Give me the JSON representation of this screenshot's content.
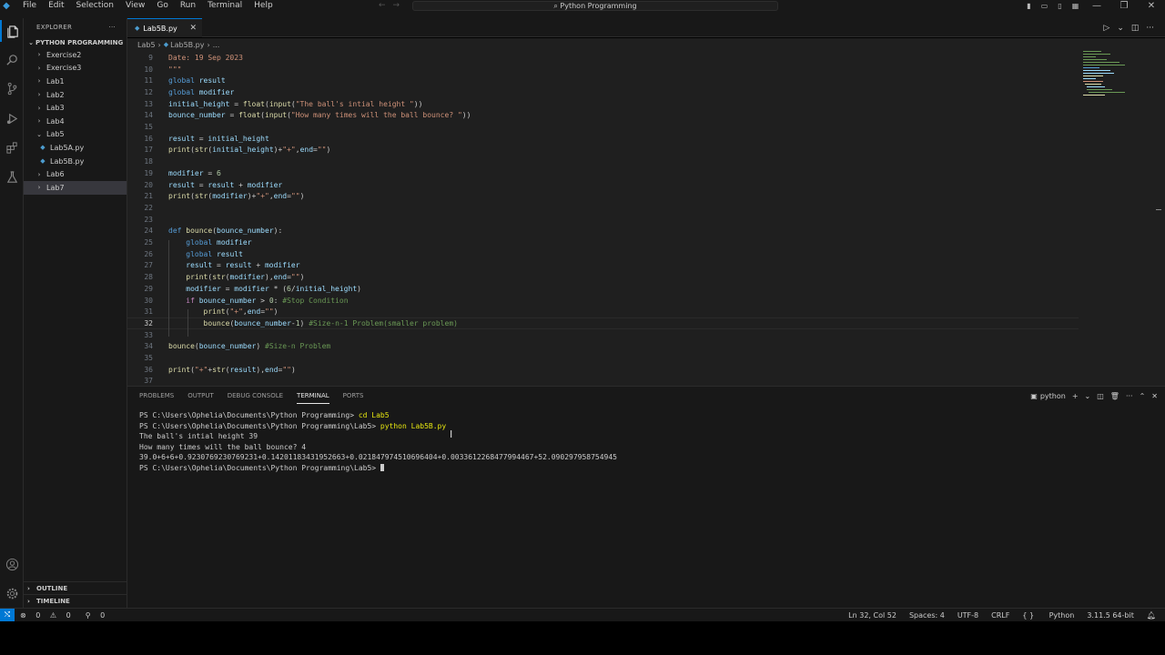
{
  "menu": [
    "File",
    "Edit",
    "Selection",
    "View",
    "Go",
    "Run",
    "Terminal",
    "Help"
  ],
  "command_center": "Python Programming",
  "sidebar": {
    "header": "EXPLORER",
    "project": "PYTHON PROGRAMMING",
    "items": [
      {
        "label": "Exercise2",
        "type": "folder",
        "expanded": false,
        "depth": 1
      },
      {
        "label": "Exercise3",
        "type": "folder",
        "expanded": false,
        "depth": 1
      },
      {
        "label": "Lab1",
        "type": "folder",
        "expanded": false,
        "depth": 1
      },
      {
        "label": "Lab2",
        "type": "folder",
        "expanded": false,
        "depth": 1
      },
      {
        "label": "Lab3",
        "type": "folder",
        "expanded": false,
        "depth": 1
      },
      {
        "label": "Lab4",
        "type": "folder",
        "expanded": false,
        "depth": 1
      },
      {
        "label": "Lab5",
        "type": "folder",
        "expanded": true,
        "depth": 1
      },
      {
        "label": "Lab5A.py",
        "type": "file",
        "depth": 2
      },
      {
        "label": "Lab5B.py",
        "type": "file",
        "depth": 2
      },
      {
        "label": "Lab6",
        "type": "folder",
        "expanded": false,
        "depth": 1
      },
      {
        "label": "Lab7",
        "type": "folder",
        "expanded": false,
        "depth": 1,
        "selected": true
      }
    ],
    "outline": "OUTLINE",
    "timeline": "TIMELINE"
  },
  "tab": {
    "label": "Lab5B.py"
  },
  "breadcrumb": [
    "Lab5",
    "Lab5B.py",
    "..."
  ],
  "editor": {
    "current_line": 32,
    "lines": [
      {
        "n": 9,
        "html": "<span class='str'>Date: 19 Sep 2023</span>"
      },
      {
        "n": 10,
        "html": "<span class='str'>\"\"\"</span>"
      },
      {
        "n": 11,
        "html": "<span class='kw'>global</span> <span class='var'>result</span>"
      },
      {
        "n": 12,
        "html": "<span class='kw'>global</span> <span class='var'>modifier</span>"
      },
      {
        "n": 13,
        "html": "<span class='var'>initial_height</span> = <span class='fn'>float</span>(<span class='fn'>input</span>(<span class='str'>\"The ball's intial height \"</span>))"
      },
      {
        "n": 14,
        "html": "<span class='var'>bounce_number</span> = <span class='fn'>float</span>(<span class='fn'>input</span>(<span class='str'>\"How many times will the ball bounce? \"</span>))"
      },
      {
        "n": 15,
        "html": ""
      },
      {
        "n": 16,
        "html": "<span class='var'>result</span> = <span class='var'>initial_height</span>"
      },
      {
        "n": 17,
        "html": "<span class='fn'>print</span>(<span class='fn'>str</span>(<span class='var'>initial_height</span>)+<span class='str'>\"+\"</span>,<span class='var'>end</span>=<span class='str'>\"\"</span>)"
      },
      {
        "n": 18,
        "html": ""
      },
      {
        "n": 19,
        "html": "<span class='var'>modifier</span> = <span class='num'>6</span>"
      },
      {
        "n": 20,
        "html": "<span class='var'>result</span> = <span class='var'>result</span> + <span class='var'>modifier</span>"
      },
      {
        "n": 21,
        "html": "<span class='fn'>print</span>(<span class='fn'>str</span>(<span class='var'>modifier</span>)+<span class='str'>\"+\"</span>,<span class='var'>end</span>=<span class='str'>\"\"</span>)"
      },
      {
        "n": 22,
        "html": ""
      },
      {
        "n": 23,
        "html": ""
      },
      {
        "n": 24,
        "html": "<span class='kw'>def</span> <span class='fn'>bounce</span>(<span class='var'>bounce_number</span>):"
      },
      {
        "n": 25,
        "html": "    <span class='kw'>global</span> <span class='var'>modifier</span>"
      },
      {
        "n": 26,
        "html": "    <span class='kw'>global</span> <span class='var'>result</span>"
      },
      {
        "n": 27,
        "html": "    <span class='var'>result</span> = <span class='var'>result</span> + <span class='var'>modifier</span>"
      },
      {
        "n": 28,
        "html": "    <span class='fn'>print</span>(<span class='fn'>str</span>(<span class='var'>modifier</span>),<span class='var'>end</span>=<span class='str'>\"\"</span>)"
      },
      {
        "n": 29,
        "html": "    <span class='var'>modifier</span> = <span class='var'>modifier</span> * (<span class='num'>6</span>/<span class='var'>initial_height</span>)"
      },
      {
        "n": 30,
        "html": "    <span class='kw2'>if</span> <span class='var'>bounce_number</span> &gt; <span class='num'>0</span>: <span class='com'>#Stop Condition</span>"
      },
      {
        "n": 31,
        "html": "        <span class='fn'>print</span>(<span class='str'>\"+\"</span>,<span class='var'>end</span>=<span class='str'>\"\"</span>)"
      },
      {
        "n": 32,
        "html": "        <span class='fn'>bounce</span>(<span class='var'>bounce_number</span>-<span class='num'>1</span>) <span class='com'>#Size-n-1 Problem(smaller problem)</span>"
      },
      {
        "n": 33,
        "html": ""
      },
      {
        "n": 34,
        "html": "<span class='fn'>bounce</span>(<span class='var'>bounce_number</span>) <span class='com'>#Size-n Problem</span>"
      },
      {
        "n": 35,
        "html": ""
      },
      {
        "n": 36,
        "html": "<span class='fn'>print</span>(<span class='str'>\"+\"</span>+<span class='fn'>str</span>(<span class='var'>result</span>),<span class='var'>end</span>=<span class='str'>\"\"</span>)"
      },
      {
        "n": 37,
        "html": ""
      }
    ]
  },
  "panel": {
    "tabs": [
      "PROBLEMS",
      "OUTPUT",
      "DEBUG CONSOLE",
      "TERMINAL",
      "PORTS"
    ],
    "active_tab": "TERMINAL",
    "shell": "python",
    "terminal": [
      {
        "prompt": "PS C:\\Users\\Ophelia\\Documents\\Python Programming> ",
        "cmd": "cd Lab5"
      },
      {
        "prompt": "PS C:\\Users\\Ophelia\\Documents\\Python Programming\\Lab5> ",
        "cmd": "python Lab5B.py"
      },
      {
        "text": "The ball's intial height 39"
      },
      {
        "text": "How many times will the ball bounce? 4"
      },
      {
        "text": "39.0+6+6+0.9230769230769231+0.14201183431952663+0.021847974510696404+0.0033612268477994467+52.090297958754945"
      },
      {
        "prompt": "PS C:\\Users\\Ophelia\\Documents\\Python Programming\\Lab5> ",
        "cursor": true
      }
    ]
  },
  "status": {
    "errors": "0",
    "warnings": "0",
    "ports": "0",
    "position": "Ln 32, Col 52",
    "spaces": "Spaces: 4",
    "encoding": "UTF-8",
    "eol": "CRLF",
    "language": "Python",
    "interpreter": "3.11.5 64-bit"
  },
  "colors": {
    "accent": "#0078d4",
    "editor_bg": "#1f1f1f",
    "chrome_bg": "#181818"
  }
}
